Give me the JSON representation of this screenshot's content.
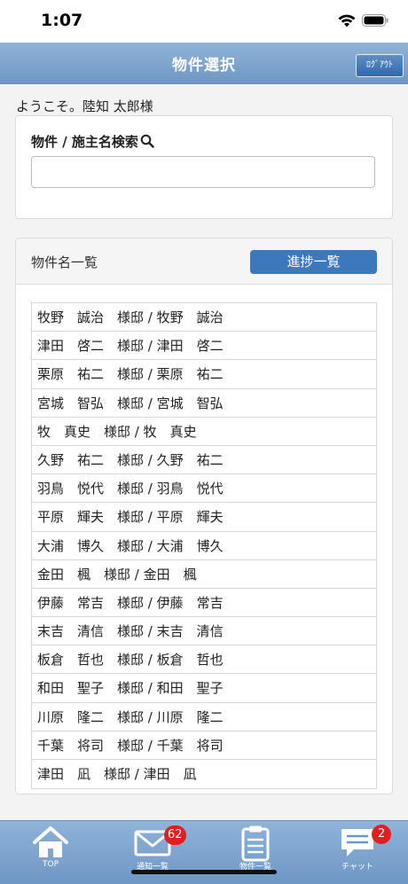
{
  "status_bar": {
    "time": "1:07"
  },
  "header": {
    "title": "物件選択",
    "logout_label": "ﾛｸﾞｱｳﾄ"
  },
  "welcome": "ようこそ。陸知 太郎様",
  "search": {
    "label": "物件 / 施主名検索",
    "value": "",
    "placeholder": ""
  },
  "list": {
    "title": "物件名一覧",
    "progress_button": "進捗一覧",
    "items": [
      "牧野　誠治　様邸 / 牧野　誠治",
      "津田　啓二　様邸 / 津田　啓二",
      "栗原　祐二　様邸 / 栗原　祐二",
      "宮城　智弘　様邸 / 宮城　智弘",
      "牧　真史　様邸 / 牧　真史",
      "久野　祐二　様邸 / 久野　祐二",
      "羽鳥　悦代　様邸 / 羽鳥　悦代",
      "平原　輝夫　様邸 / 平原　輝夫",
      "大浦　博久　様邸 / 大浦　博久",
      "金田　楓　様邸 / 金田　楓",
      "伊藤　常吉　様邸 / 伊藤　常吉",
      "末吉　清信　様邸 / 末吉　清信",
      "板倉　哲也　様邸 / 板倉　哲也",
      "和田　聖子　様邸 / 和田　聖子",
      "川原　隆二　様邸 / 川原　隆二",
      "千葉　将司　様邸 / 千葉　将司",
      "津田　凪　様邸 / 津田　凪"
    ]
  },
  "tabbar": {
    "home": {
      "label": "TOP",
      "icon": "home-icon"
    },
    "notifications": {
      "label": "通知一覧",
      "icon": "mail-icon",
      "badge": "62"
    },
    "properties": {
      "label": "物件一覧",
      "icon": "clipboard-icon"
    },
    "chat": {
      "label": "チャット",
      "icon": "chat-icon",
      "badge": "2"
    }
  }
}
